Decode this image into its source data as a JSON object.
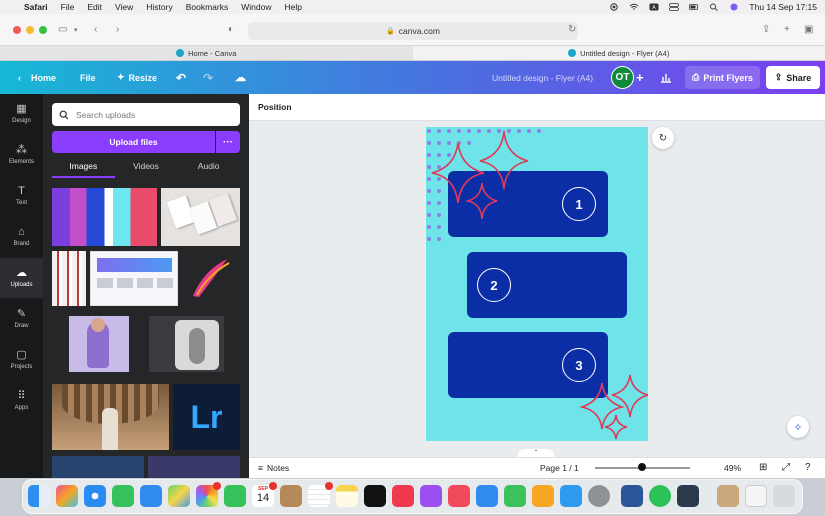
{
  "menubar": {
    "app": "Safari",
    "items": [
      "File",
      "Edit",
      "View",
      "History",
      "Bookmarks",
      "Window",
      "Help"
    ],
    "clock": "Thu 14 Sep  17:15"
  },
  "browser": {
    "url": "canva.com",
    "tabs": [
      {
        "label": "Home - Canva"
      },
      {
        "label": "Untitled design - Flyer (A4)"
      }
    ]
  },
  "header": {
    "home": "Home",
    "file": "File",
    "resize": "Resize",
    "doc_title": "Untitled design - Flyer (A4)",
    "avatar": "OT",
    "print": "Print Flyers",
    "share": "Share"
  },
  "rail": {
    "items": [
      {
        "label": "Design",
        "icon": "design-icon"
      },
      {
        "label": "Elements",
        "icon": "elements-icon"
      },
      {
        "label": "Text",
        "icon": "text-icon"
      },
      {
        "label": "Brand",
        "icon": "brand-icon"
      },
      {
        "label": "Uploads",
        "icon": "uploads-icon"
      },
      {
        "label": "Draw",
        "icon": "draw-icon"
      },
      {
        "label": "Projects",
        "icon": "projects-icon"
      },
      {
        "label": "Apps",
        "icon": "apps-icon"
      }
    ]
  },
  "uploads": {
    "search_placeholder": "Search uploads",
    "upload_button": "Upload files",
    "tabs": [
      "Images",
      "Videos",
      "Audio"
    ],
    "lr_label": "Lr"
  },
  "context_bar": {
    "position": "Position"
  },
  "design": {
    "boxes": [
      "1",
      "2",
      "3"
    ],
    "colors": {
      "background": "#6ee4e8",
      "box": "#0b2ea7",
      "sparkle": "#e0395a"
    }
  },
  "footer": {
    "notes": "Notes",
    "page": "Page 1 / 1",
    "zoom": "49%",
    "zoom_level": 0.49
  },
  "dock": {
    "calendar_month": "SEP",
    "calendar_day": "14"
  },
  "colors": {
    "accent": "#8b3dff",
    "panel": "#252628",
    "rail": "#18191b"
  }
}
